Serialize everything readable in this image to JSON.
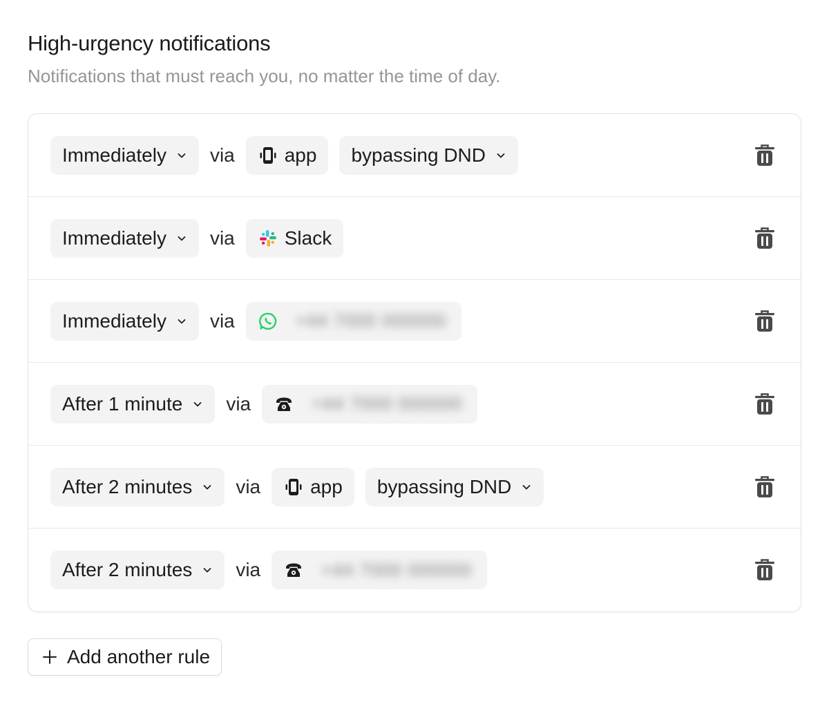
{
  "header": {
    "title": "High-urgency notifications",
    "subtitle": "Notifications that must reach you, no matter the time of day."
  },
  "via_label": "via",
  "rules": [
    {
      "delay": "Immediately",
      "channel": {
        "icon": "mobile-app-icon",
        "label": "app"
      },
      "dnd": "bypassing DND"
    },
    {
      "delay": "Immediately",
      "channel": {
        "icon": "slack-icon",
        "label": "Slack"
      }
    },
    {
      "delay": "Immediately",
      "channel": {
        "icon": "whatsapp-icon",
        "label": "+44 7000 000000"
      }
    },
    {
      "delay": "After 1 minute",
      "channel": {
        "icon": "phone-icon",
        "label": "+44 7000 000000"
      }
    },
    {
      "delay": "After 2 minutes",
      "channel": {
        "icon": "mobile-app-icon",
        "label": "app"
      },
      "dnd": "bypassing DND"
    },
    {
      "delay": "After 2 minutes",
      "channel": {
        "icon": "phone-icon",
        "label": "+44 7000 000000"
      }
    }
  ],
  "add_rule_label": "Add another rule",
  "colors": {
    "pill_bg": "#f3f3f3",
    "whatsapp": "#25d366",
    "subtitle": "#959595"
  }
}
